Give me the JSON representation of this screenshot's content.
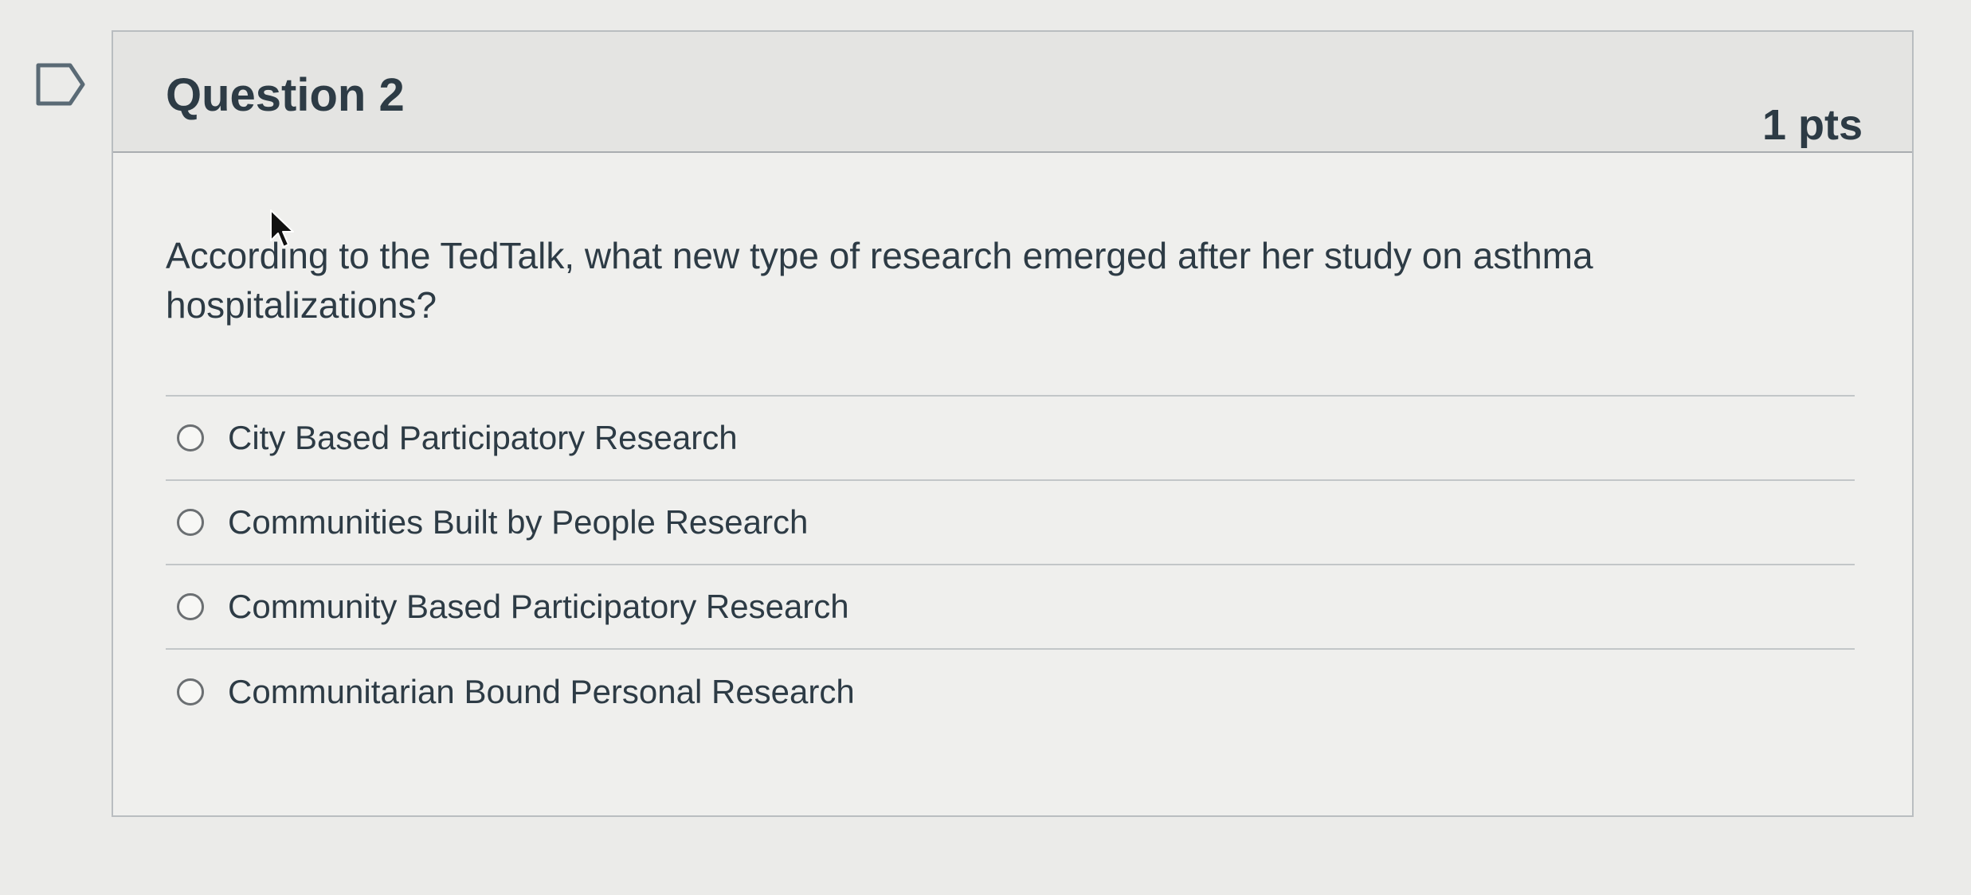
{
  "question": {
    "title": "Question 2",
    "points": "1 pts",
    "text": "According to the TedTalk, what new type of research emerged after her study on asthma hospitalizations?",
    "answers": [
      {
        "label": "City Based Participatory Research",
        "selected": false
      },
      {
        "label": "Communities Built by People Research",
        "selected": false
      },
      {
        "label": "Community Based Participatory Research",
        "selected": false
      },
      {
        "label": "Communitarian Bound Personal Research",
        "selected": false
      }
    ]
  },
  "icons": {
    "flag": "bookmark-flag-icon",
    "cursor": "mouse-pointer-icon"
  },
  "colors": {
    "text": "#2d3b45",
    "header_bg": "#e4e4e2",
    "border": "#b9bdc0"
  }
}
